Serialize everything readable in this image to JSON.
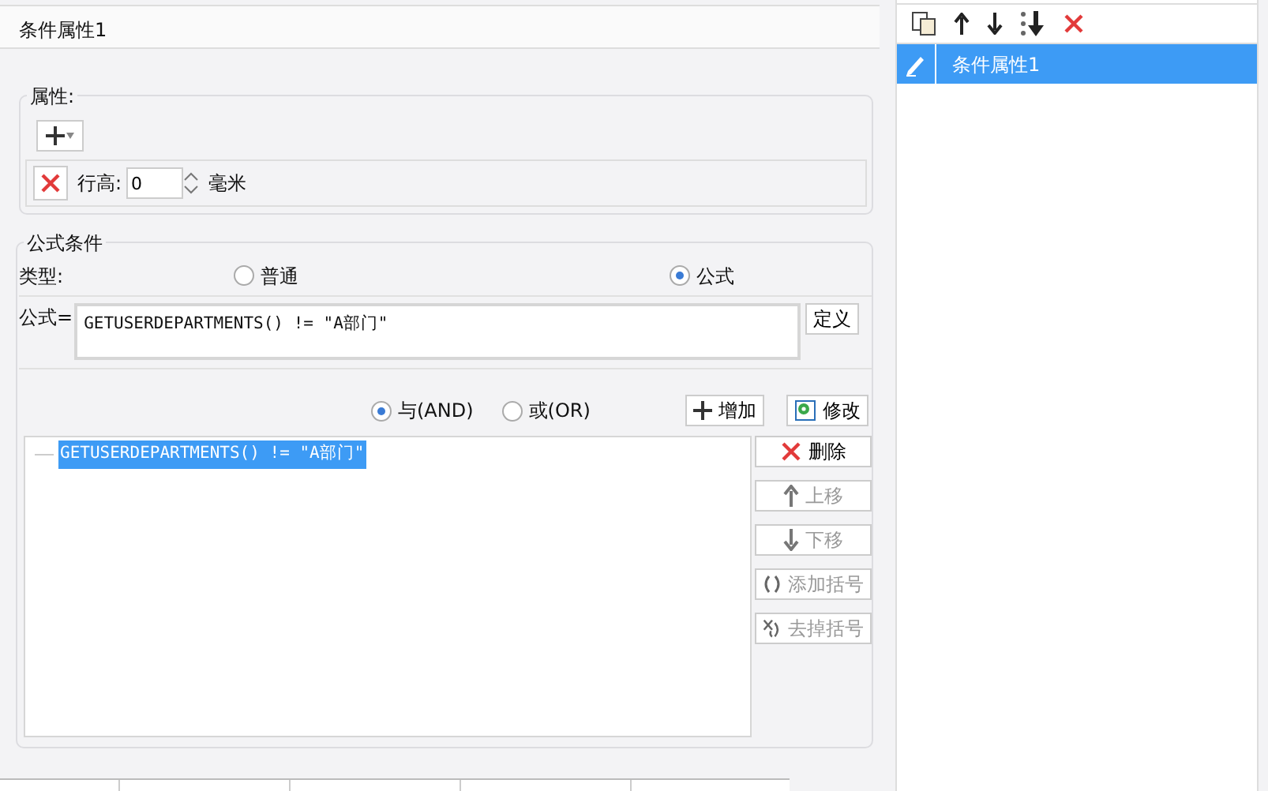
{
  "title": "条件属性1",
  "properties": {
    "legend": "属性:",
    "row_height_label": "行高:",
    "row_height_value": "0",
    "row_height_unit": "毫米"
  },
  "condition": {
    "legend": "公式条件",
    "type_label": "类型:",
    "types": [
      {
        "label": "普通",
        "selected": false
      },
      {
        "label": "公式",
        "selected": true
      }
    ],
    "formula_label": "公式=",
    "formula": "GETUSERDEPARTMENTS() != \"A部门\"",
    "define_button": "定义",
    "logic": [
      {
        "label": "与(AND)",
        "selected": true
      },
      {
        "label": "或(OR)",
        "selected": false
      }
    ],
    "add_button": "增加",
    "edit_button": "修改",
    "conditions": [
      {
        "text": "GETUSERDEPARTMENTS() != \"A部门\"",
        "selected": true
      }
    ],
    "actions": [
      {
        "kind": "delete",
        "label": "删除",
        "disabled": false
      },
      {
        "kind": "up",
        "label": "上移",
        "disabled": true
      },
      {
        "kind": "down",
        "label": "下移",
        "disabled": true
      },
      {
        "kind": "add-paren",
        "label": "添加括号",
        "disabled": true
      },
      {
        "kind": "remove-paren",
        "label": "去掉括号",
        "disabled": true
      }
    ]
  },
  "list_panel": {
    "items": [
      {
        "label": "条件属性1",
        "selected": true
      }
    ]
  }
}
